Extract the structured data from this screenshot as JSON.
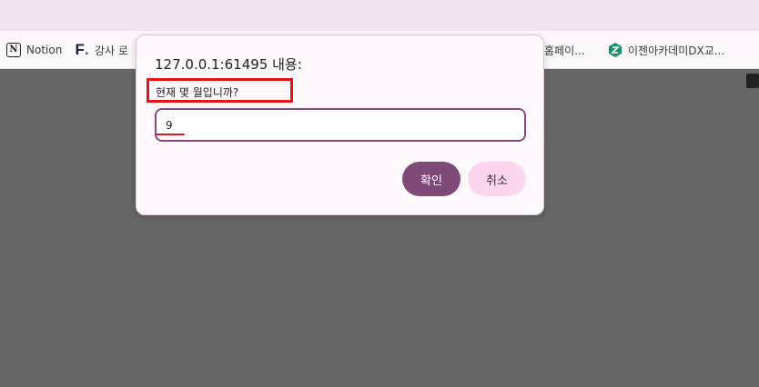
{
  "bookmarks": [
    {
      "label": "Notion",
      "icon": "notion-icon"
    },
    {
      "label": "강사 로",
      "icon": "fastcampus-icon"
    },
    {
      "label": "홈페이...",
      "icon": ""
    },
    {
      "label": "이젠아카데미DX교...",
      "icon": "academy-icon"
    }
  ],
  "dialog": {
    "title": "127.0.0.1:61495 내용:",
    "message": "현재 몇 월입니까?",
    "input_value": "9",
    "ok_label": "확인",
    "cancel_label": "취소"
  },
  "colors": {
    "overlay": "#666666",
    "dialog_bg": "#fff8fc",
    "input_border": "#8a4a80",
    "ok_button": "#7f4a78",
    "cancel_button": "#fbd6ee",
    "annotation_red": "#e0141a"
  }
}
